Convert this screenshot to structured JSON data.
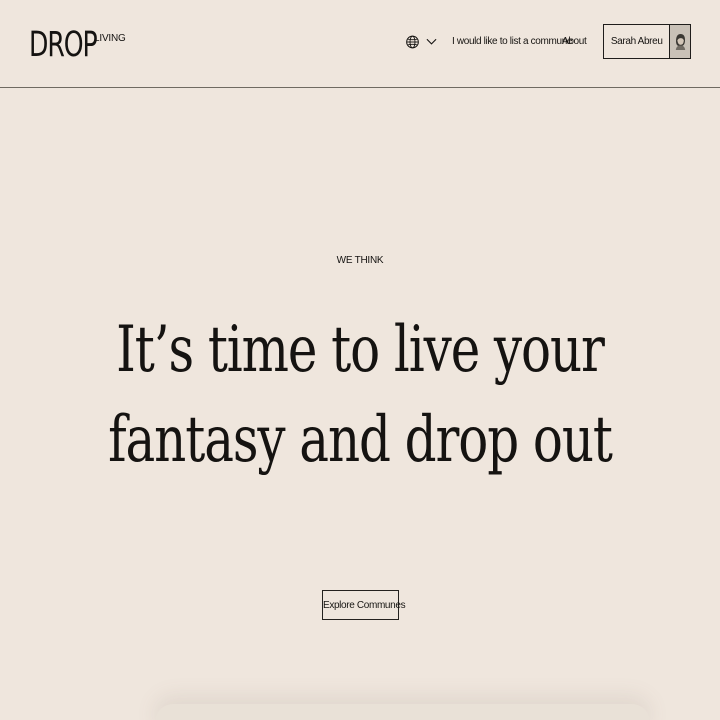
{
  "header": {
    "brand": {
      "name": "DROP",
      "tag": "LIVING"
    },
    "language": {
      "icon": "globe-icon",
      "dropdown_icon": "chevron-down-icon"
    },
    "nav": {
      "list_commune": "I would like to list a commune",
      "about": "About"
    },
    "user": {
      "name": "Sarah Abreu",
      "avatar_icon": "avatar"
    }
  },
  "hero": {
    "eyebrow": "WE THINK",
    "title_line_1": "It’s time to live your",
    "title_line_2": "fantasy and drop out",
    "cta": "Explore Communes"
  },
  "colors": {
    "background": "#efe6dd",
    "text": "#151311",
    "divider": "#6f6a61"
  }
}
